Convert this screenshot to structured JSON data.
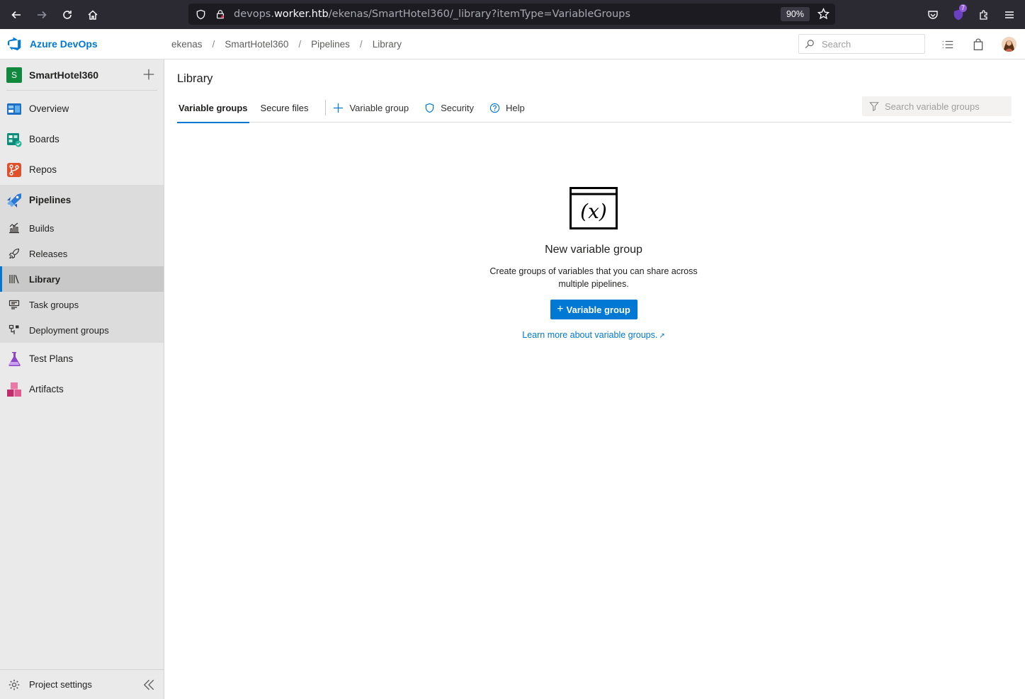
{
  "browser": {
    "url_prefix": "devops.",
    "url_host": "worker.htb",
    "url_path": "/ekenas/SmartHotel360/_library?itemType=VariableGroups",
    "zoom": "90%",
    "extension_badge": "7"
  },
  "header": {
    "brand": "Azure DevOps",
    "breadcrumb": [
      "ekenas",
      "SmartHotel360",
      "Pipelines",
      "Library"
    ],
    "search_placeholder": "Search"
  },
  "sidebar": {
    "project_initial": "S",
    "project_name": "SmartHotel360",
    "items": [
      {
        "label": "Overview",
        "icon": "overview-icon"
      },
      {
        "label": "Boards",
        "icon": "boards-icon"
      },
      {
        "label": "Repos",
        "icon": "repos-icon"
      },
      {
        "label": "Pipelines",
        "icon": "pipelines-icon"
      },
      {
        "label": "Test Plans",
        "icon": "test-plans-icon"
      },
      {
        "label": "Artifacts",
        "icon": "artifacts-icon"
      }
    ],
    "pipeline_subitems": [
      {
        "label": "Builds",
        "icon": "builds-icon"
      },
      {
        "label": "Releases",
        "icon": "releases-icon"
      },
      {
        "label": "Library",
        "icon": "library-icon"
      },
      {
        "label": "Task groups",
        "icon": "task-groups-icon"
      },
      {
        "label": "Deployment groups",
        "icon": "deployment-groups-icon"
      }
    ],
    "settings_label": "Project settings"
  },
  "main": {
    "title": "Library",
    "tabs": [
      "Variable groups",
      "Secure files"
    ],
    "commands": {
      "add_variable_group": "Variable group",
      "security": "Security",
      "help": "Help"
    },
    "filter_placeholder": "Search variable groups",
    "empty": {
      "icon_text": "(x)",
      "title": "New variable group",
      "description": "Create groups of variables that you can share across multiple pipelines.",
      "button_label": "Variable group",
      "link_text": "Learn more about variable groups."
    }
  },
  "colors": {
    "accent": "#0078d4",
    "project_avatar": "#10893e",
    "browser_chrome": "#2b2a33"
  }
}
